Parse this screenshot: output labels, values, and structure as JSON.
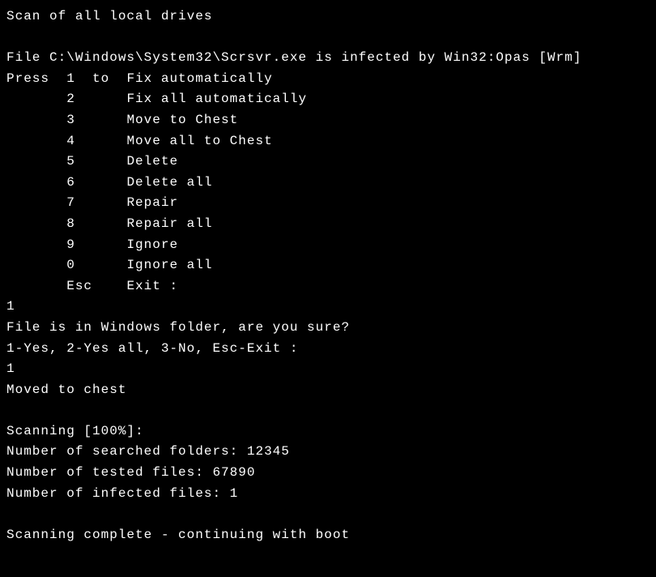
{
  "title": "Scan of all local drives",
  "infection_line": "File C:\\Windows\\System32\\Scrsvr.exe is infected by Win32:Opas [Wrm]",
  "press_label": "Press",
  "to_label": "to",
  "options": [
    {
      "key": "1",
      "label": "Fix automatically"
    },
    {
      "key": "2",
      "label": "Fix all automatically"
    },
    {
      "key": "3",
      "label": "Move to Chest"
    },
    {
      "key": "4",
      "label": "Move all to Chest"
    },
    {
      "key": "5",
      "label": "Delete"
    },
    {
      "key": "6",
      "label": "Delete all"
    },
    {
      "key": "7",
      "label": "Repair"
    },
    {
      "key": "8",
      "label": "Repair all"
    },
    {
      "key": "9",
      "label": "Ignore"
    },
    {
      "key": "0",
      "label": "Ignore all"
    },
    {
      "key": "Esc",
      "label": "Exit :"
    }
  ],
  "user_input_1": "1",
  "confirm_prompt": "File is in Windows folder, are you sure?",
  "confirm_options": "1-Yes, 2-Yes all, 3-No, Esc-Exit :",
  "user_input_2": "1",
  "result_line": "Moved to chest",
  "scanning_progress": "Scanning [100%]:",
  "stats": {
    "folders_label": "Number of searched folders:",
    "folders_value": "12345",
    "files_label": "Number of tested files:",
    "files_value": "67890",
    "infected_label": "Number of infected files:",
    "infected_value": "1"
  },
  "complete_line": "Scanning complete - continuing with boot"
}
